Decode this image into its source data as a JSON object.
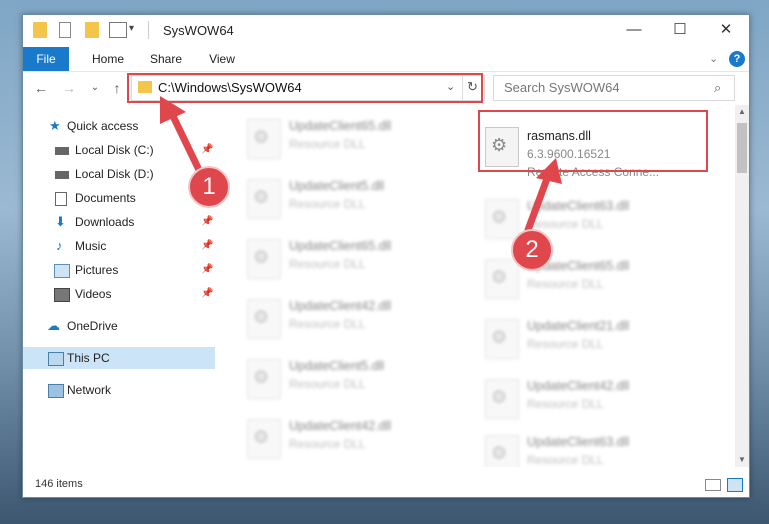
{
  "window": {
    "title": "SysWOW64",
    "controls": [
      "—",
      "☐",
      "✕"
    ]
  },
  "ribbon": {
    "tabs": [
      "File",
      "Home",
      "Share",
      "View"
    ],
    "help": "?"
  },
  "navigation": {
    "address_path": "C:\\Windows\\SysWOW64",
    "search_placeholder": "Search SysWOW64"
  },
  "nav_pane": {
    "items": [
      {
        "label": "Quick access",
        "icon": "star-icon",
        "pinned": false
      },
      {
        "label": "Local Disk (C:)",
        "icon": "drive-icon",
        "pinned": true
      },
      {
        "label": "Local Disk (D:)",
        "icon": "drive-icon",
        "pinned": false
      },
      {
        "label": "Documents",
        "icon": "documents-icon",
        "pinned": true
      },
      {
        "label": "Downloads",
        "icon": "download-icon",
        "pinned": true
      },
      {
        "label": "Music",
        "icon": "music-icon",
        "pinned": true
      },
      {
        "label": "Pictures",
        "icon": "pictures-icon",
        "pinned": true
      },
      {
        "label": "Videos",
        "icon": "videos-icon",
        "pinned": true
      },
      {
        "label": "OneDrive",
        "icon": "cloud-icon",
        "pinned": false
      },
      {
        "label": "This PC",
        "icon": "pc-icon",
        "pinned": false,
        "selected": true
      },
      {
        "label": "Network",
        "icon": "network-icon",
        "pinned": false
      }
    ]
  },
  "files": {
    "highlighted": {
      "name": "rasmans.dll",
      "version": "6.3.9600.16521",
      "description": "Remote Access Conne..."
    },
    "left_column": [
      {
        "name": "UpdateClient65.dll",
        "type": "Resource DLL"
      },
      {
        "name": "UpdateClient5.dll",
        "type": "Resource DLL"
      },
      {
        "name": "UpdateClient65.dll",
        "type": "Resource DLL"
      },
      {
        "name": "UpdateClient42.dll",
        "type": "Resource DLL"
      },
      {
        "name": "UpdateClient5.dll",
        "type": "Resource DLL"
      },
      {
        "name": "UpdateClient42.dll",
        "type": "Resource DLL"
      }
    ],
    "right_column": [
      {
        "name": "UpdateClient63.dll",
        "type": "Resource DLL"
      },
      {
        "name": "UpdateClient65.dll",
        "type": "Resource DLL"
      },
      {
        "name": "UpdateClient21.dll",
        "type": "Resource DLL"
      },
      {
        "name": "UpdateClient42.dll",
        "type": "Resource DLL"
      },
      {
        "name": "UpdateClient63.dll",
        "type": "Resource DLL"
      }
    ]
  },
  "status": {
    "item_count": "146 items"
  },
  "annotations": {
    "step1": "1",
    "step2": "2",
    "color": "#e0474c"
  }
}
